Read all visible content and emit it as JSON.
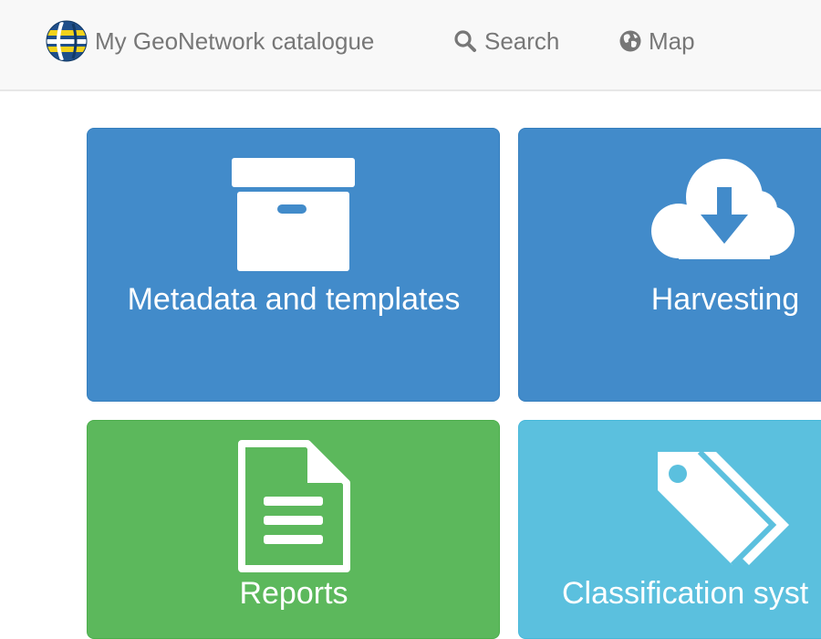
{
  "app": {
    "brand_name": "My GeoNetwork catalogue",
    "logo_icon": "geonetwork-globe-logo"
  },
  "nav": {
    "items": [
      {
        "label": "Search",
        "icon": "search-icon"
      },
      {
        "label": "Map",
        "icon": "globe-icon"
      }
    ]
  },
  "tiles": [
    {
      "label": "Metadata and templates",
      "icon": "archive-box-icon",
      "color": "#428bca"
    },
    {
      "label": "Harvesting",
      "icon": "cloud-download-icon",
      "color": "#428bca"
    },
    {
      "label": "Reports",
      "icon": "document-icon",
      "color": "#5cb85c"
    },
    {
      "label": "Classification syst",
      "icon": "tags-icon",
      "color": "#5bc0de"
    }
  ],
  "colors": {
    "navbar_bg": "#f8f8f8",
    "nav_text": "#777777",
    "primary": "#428bca",
    "success": "#5cb85c",
    "info": "#5bc0de"
  }
}
